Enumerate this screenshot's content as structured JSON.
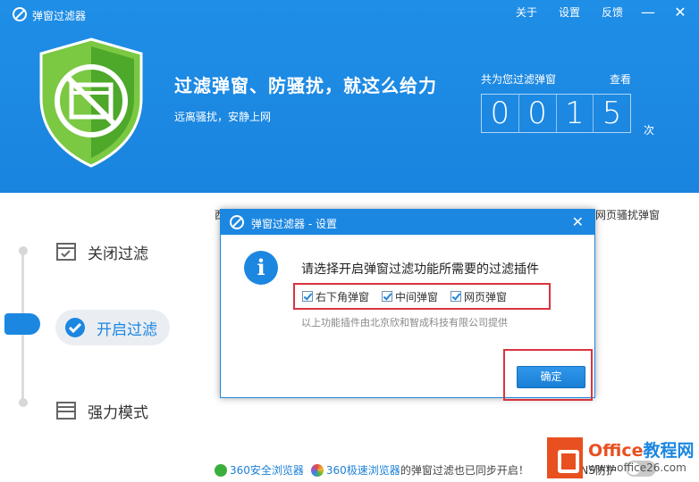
{
  "app": {
    "title": "弹窗过滤器",
    "menu": [
      "关于",
      "设置",
      "反馈"
    ],
    "minimize": "—",
    "close": "✕"
  },
  "header": {
    "headline": "过滤弹窗、防骚扰，就这么给力",
    "subline": "远离骚扰，安静上网",
    "count_label": "共为您过滤弹窗",
    "view_link": "查看",
    "digits": [
      "0",
      "0",
      "1",
      "5"
    ],
    "unit": "次"
  },
  "nav": {
    "items": [
      {
        "label": "关闭过滤",
        "icon": "checkbox-off-icon"
      },
      {
        "label": "开启过滤",
        "icon": "check-circle-icon"
      },
      {
        "label": "强力模式",
        "icon": "window-icon"
      }
    ]
  },
  "background_text": {
    "left_fragment": "西",
    "right_fragment": "/网页骚扰弹窗"
  },
  "bottom": {
    "browser1": "360安全浏览器",
    "browser2": "360极速浏览器",
    "suffix": "的弹窗过滤也已同步开启！",
    "dns_label": "DNS防护"
  },
  "dialog": {
    "title": "弹窗过滤器 - 设置",
    "close": "✕",
    "question": "请选择开启弹窗过滤功能所需要的过滤插件",
    "options": [
      {
        "label": "右下角弹窗",
        "checked": true
      },
      {
        "label": "中间弹窗",
        "checked": true
      },
      {
        "label": "网页弹窗",
        "checked": true
      }
    ],
    "note": "以上功能插件由北京欣和智成科技有限公司提供",
    "ok_label": "确定"
  },
  "watermark": {
    "brand_a": "Office",
    "brand_b": "教程网",
    "url": "www.office26.com"
  },
  "colors": {
    "header_blue": "#1c87e1",
    "shield_green": "#5cb531",
    "highlight_red": "#d9343f",
    "watermark_orange": "#e8501f"
  }
}
